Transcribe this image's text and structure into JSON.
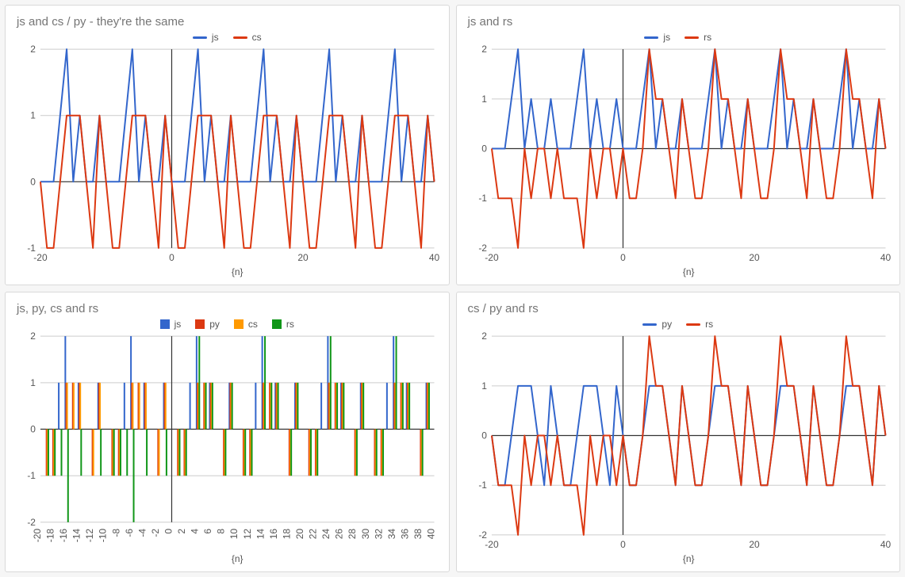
{
  "palette": {
    "blue": "#3366cc",
    "red": "#dc3912",
    "orange": "#ff9900",
    "green": "#109618"
  },
  "n": [
    -20,
    -19,
    -18,
    -17,
    -16,
    -15,
    -14,
    -13,
    -12,
    -11,
    -10,
    -9,
    -8,
    -7,
    -6,
    -5,
    -4,
    -3,
    -2,
    -1,
    0,
    1,
    2,
    3,
    4,
    5,
    6,
    7,
    8,
    9,
    10,
    11,
    12,
    13,
    14,
    15,
    16,
    17,
    18,
    19,
    20,
    21,
    22,
    23,
    24,
    25,
    26,
    27,
    28,
    29,
    30,
    31,
    32,
    33,
    34,
    35,
    36,
    37,
    38,
    39,
    40
  ],
  "series": {
    "js": [
      0,
      0,
      0,
      1,
      2,
      0,
      1,
      0,
      0,
      1,
      0,
      0,
      0,
      1,
      2,
      0,
      1,
      0,
      0,
      1,
      0,
      0,
      0,
      1,
      2,
      0,
      1,
      0,
      0,
      1,
      0,
      0,
      0,
      1,
      2,
      0,
      1,
      0,
      0,
      1,
      0,
      0,
      0,
      1,
      2,
      0,
      1,
      0,
      0,
      1,
      0,
      0,
      0,
      1,
      2,
      0,
      1,
      0,
      0,
      1,
      0
    ],
    "cs": [
      0,
      -1,
      -1,
      0,
      1,
      1,
      1,
      0,
      -1,
      1,
      0,
      -1,
      -1,
      0,
      1,
      1,
      1,
      0,
      -1,
      1,
      0,
      -1,
      -1,
      0,
      1,
      1,
      1,
      0,
      -1,
      1,
      0,
      -1,
      -1,
      0,
      1,
      1,
      1,
      0,
      -1,
      1,
      0,
      -1,
      -1,
      0,
      1,
      1,
      1,
      0,
      -1,
      1,
      0,
      -1,
      -1,
      0,
      1,
      1,
      1,
      0,
      -1,
      1,
      0
    ],
    "py": [
      0,
      -1,
      -1,
      0,
      1,
      1,
      1,
      0,
      -1,
      1,
      0,
      -1,
      -1,
      0,
      1,
      1,
      1,
      0,
      -1,
      1,
      0,
      -1,
      -1,
      0,
      1,
      1,
      1,
      0,
      -1,
      1,
      0,
      -1,
      -1,
      0,
      1,
      1,
      1,
      0,
      -1,
      1,
      0,
      -1,
      -1,
      0,
      1,
      1,
      1,
      0,
      -1,
      1,
      0,
      -1,
      -1,
      0,
      1,
      1,
      1,
      0,
      -1,
      1,
      0
    ],
    "rs": [
      0,
      -1,
      -1,
      -1,
      -2,
      0,
      -1,
      0,
      0,
      -1,
      0,
      -1,
      -1,
      -1,
      -2,
      0,
      -1,
      0,
      0,
      -1,
      0,
      -1,
      -1,
      0,
      2,
      1,
      1,
      0,
      -1,
      1,
      0,
      -1,
      -1,
      0,
      2,
      1,
      1,
      0,
      -1,
      1,
      0,
      -1,
      -1,
      0,
      2,
      1,
      1,
      0,
      -1,
      1,
      0,
      -1,
      -1,
      0,
      2,
      1,
      1,
      0,
      -1,
      1,
      0
    ]
  },
  "chart_data": [
    {
      "type": "line",
      "title": "js and cs / py - they're the same",
      "xlabel": "{n}",
      "categories_from": "n",
      "series": [
        {
          "name": "js",
          "color": "blue",
          "from": "js"
        },
        {
          "name": "cs",
          "color": "red",
          "from": "cs"
        }
      ],
      "xlim": [
        -20,
        40
      ],
      "ylim": [
        -1,
        2
      ],
      "xticks": [
        -20,
        0,
        20,
        40
      ],
      "yticks": [
        -1,
        0,
        1,
        2
      ],
      "legend_style": "line"
    },
    {
      "type": "line",
      "title": "js and rs",
      "xlabel": "{n}",
      "categories_from": "n",
      "series": [
        {
          "name": "js",
          "color": "blue",
          "from": "js"
        },
        {
          "name": "rs",
          "color": "red",
          "from": "rs"
        }
      ],
      "xlim": [
        -20,
        40
      ],
      "ylim": [
        -2,
        2
      ],
      "xticks": [
        -20,
        0,
        20,
        40
      ],
      "yticks": [
        -2,
        -1,
        0,
        1,
        2
      ],
      "legend_style": "line"
    },
    {
      "type": "bar_stick",
      "title": "js, py, cs and rs",
      "xlabel": "{n}",
      "categories_from": "n",
      "series": [
        {
          "name": "js",
          "color": "blue",
          "from": "js"
        },
        {
          "name": "py",
          "color": "red",
          "from": "py"
        },
        {
          "name": "cs",
          "color": "orange",
          "from": "cs"
        },
        {
          "name": "rs",
          "color": "green",
          "from": "rs"
        }
      ],
      "xlim": [
        -20,
        40
      ],
      "ylim": [
        -2,
        2
      ],
      "xticks": [
        -20,
        -18,
        -16,
        -14,
        -12,
        -10,
        -8,
        -6,
        -4,
        -2,
        0,
        2,
        4,
        6,
        8,
        10,
        12,
        14,
        16,
        18,
        20,
        22,
        24,
        26,
        28,
        30,
        32,
        34,
        36,
        38,
        40
      ],
      "yticks": [
        -2,
        -1,
        0,
        1,
        2
      ],
      "legend_style": "square"
    },
    {
      "type": "line",
      "title": "cs / py and rs",
      "xlabel": "{n}",
      "categories_from": "n",
      "series": [
        {
          "name": "py",
          "color": "blue",
          "from": "py"
        },
        {
          "name": "rs",
          "color": "red",
          "from": "rs"
        }
      ],
      "xlim": [
        -20,
        40
      ],
      "ylim": [
        -2,
        2
      ],
      "xticks": [
        -20,
        0,
        20,
        40
      ],
      "yticks": [
        -2,
        -1,
        0,
        1,
        2
      ],
      "legend_style": "line"
    }
  ]
}
